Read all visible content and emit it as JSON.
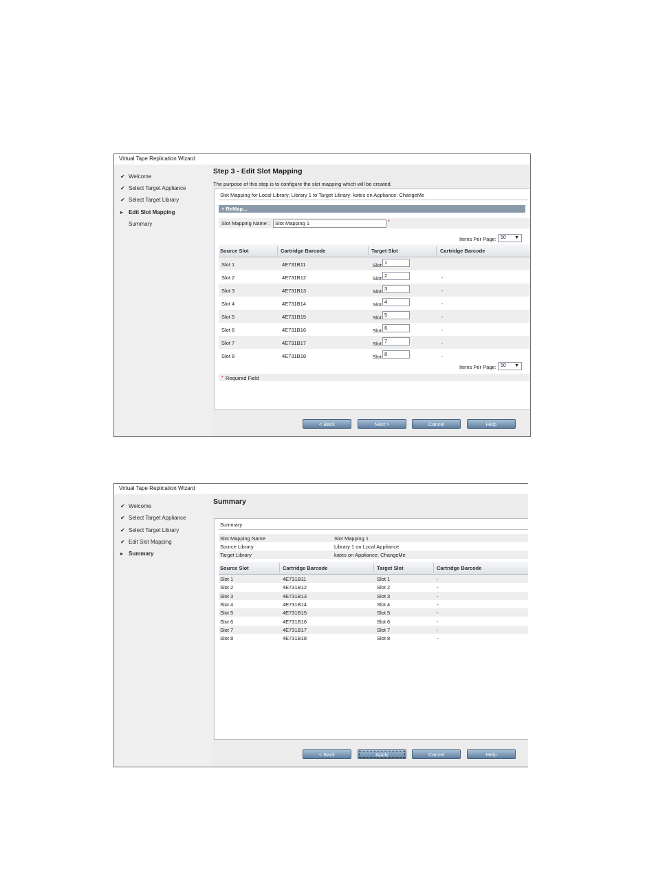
{
  "wizard": {
    "title": "Virtual Tape Replication Wizard",
    "steps": [
      "Welcome",
      "Select Target Appliance",
      "Select Target Library",
      "Edit Slot Mapping",
      "Summary"
    ],
    "check_glyph": "✔",
    "arrow_glyph": "▸"
  },
  "step3": {
    "heading": "Step 3 - Edit Slot Mapping",
    "description": "The purpose of this step is to configure the slot mapping which will be created.",
    "panel_title": "Slot Mapping for Local Library: Library 1 to Target Library: kates on Appliance: ChangeMe",
    "remap_label": "+ ReMap...",
    "mapping_name_label": "Slot Mapping Name :",
    "mapping_name_value": "Slot Mapping 1",
    "required_star": "*",
    "items_per_page_label": "Items Per Page:",
    "items_per_page_value": "50",
    "columns": [
      "Source Slot",
      "Cartridge Barcode",
      "Target Slot",
      "Cartridge Barcode"
    ],
    "target_prefix": "Slot",
    "rows": [
      {
        "source": "Slot 1",
        "barcode": "4E731B11",
        "target": "1",
        "target_barcode": ""
      },
      {
        "source": "Slot 2",
        "barcode": "4E731B12",
        "target": "2",
        "target_barcode": "-"
      },
      {
        "source": "Slot 3",
        "barcode": "4E731B13",
        "target": "3",
        "target_barcode": "-"
      },
      {
        "source": "Slot 4",
        "barcode": "4E731B14",
        "target": "4",
        "target_barcode": "-"
      },
      {
        "source": "Slot 5",
        "barcode": "4E731B15",
        "target": "5",
        "target_barcode": "-"
      },
      {
        "source": "Slot 6",
        "barcode": "4E731B16",
        "target": "6",
        "target_barcode": "-"
      },
      {
        "source": "Slot 7",
        "barcode": "4E731B17",
        "target": "7",
        "target_barcode": "-"
      },
      {
        "source": "Slot 8",
        "barcode": "4E731B18",
        "target": "8",
        "target_barcode": "-"
      }
    ],
    "required_note": "Required Field",
    "buttons": {
      "back": "< Back",
      "next": "Next >",
      "cancel": "Cancel",
      "help": "Help"
    }
  },
  "summary": {
    "heading": "Summary",
    "panel_title": "Summary",
    "info": [
      {
        "label": "Slot Mapping Name",
        "value": "Slot Mapping 1"
      },
      {
        "label": "Source Library",
        "value": "Library 1 on Local Appliance"
      },
      {
        "label": "Target Library",
        "value": "kates on Appliance: ChangeMe"
      }
    ],
    "columns": [
      "Source Slot",
      "Cartridge Barcode",
      "Target Slot",
      "Cartridge Barcode"
    ],
    "rows": [
      {
        "source": "Slot 1",
        "barcode": "4E731B11",
        "target": "Slot 1",
        "target_barcode": "-"
      },
      {
        "source": "Slot 2",
        "barcode": "4E731B12",
        "target": "Slot 2",
        "target_barcode": "-"
      },
      {
        "source": "Slot 3",
        "barcode": "4E731B13",
        "target": "Slot 3",
        "target_barcode": "-"
      },
      {
        "source": "Slot 4",
        "barcode": "4E731B14",
        "target": "Slot 4",
        "target_barcode": "-"
      },
      {
        "source": "Slot 5",
        "barcode": "4E731B15",
        "target": "Slot 5",
        "target_barcode": "-"
      },
      {
        "source": "Slot 6",
        "barcode": "4E731B16",
        "target": "Slot 6",
        "target_barcode": "-"
      },
      {
        "source": "Slot 7",
        "barcode": "4E731B17",
        "target": "Slot 7",
        "target_barcode": "-"
      },
      {
        "source": "Slot 8",
        "barcode": "4E731B18",
        "target": "Slot 8",
        "target_barcode": "-"
      }
    ],
    "buttons": {
      "back": "< Back",
      "apply": "Apply",
      "cancel": "Cancel",
      "help": "Help"
    }
  },
  "colors": {
    "accent_bar": "#8a9aab",
    "button": "#6a8aa9",
    "required": "#cc0000"
  }
}
